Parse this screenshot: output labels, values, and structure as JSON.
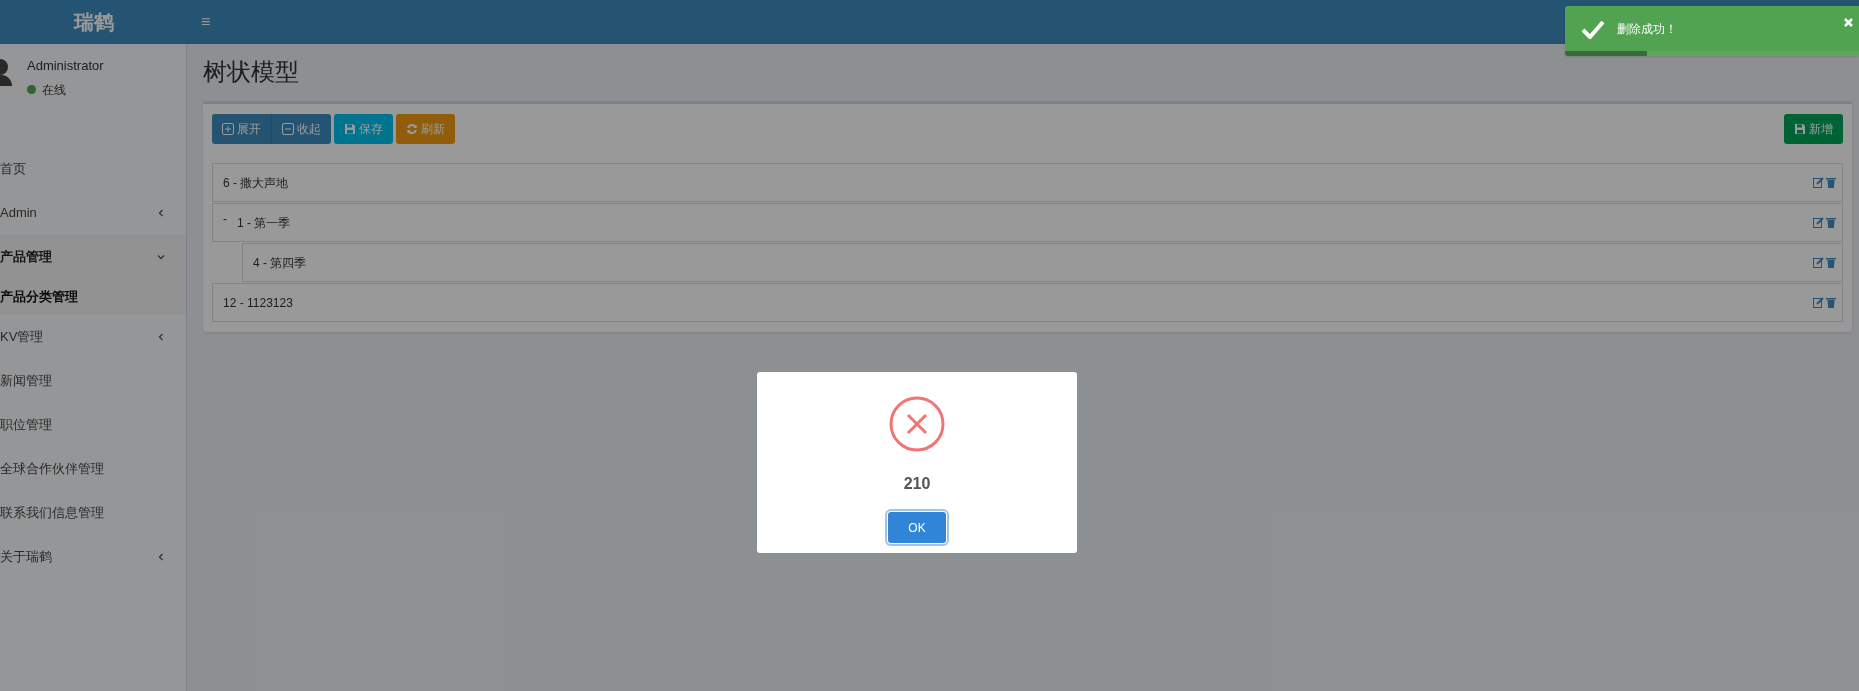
{
  "header": {
    "logo": "瑞鹤",
    "menu_toggle": "≡"
  },
  "sidebar": {
    "user": {
      "name": "Administrator",
      "status": {
        "text": "在线",
        "color": "#2e6435"
      }
    },
    "items": [
      {
        "label": "首页",
        "kind": "link",
        "selected": false
      },
      {
        "label": "Admin",
        "kind": "group",
        "expanded": false,
        "selected": false
      },
      {
        "label": "产品管理",
        "kind": "group",
        "expanded": true,
        "selected": true,
        "children": [
          {
            "label": "产品分类管理",
            "selected": true
          }
        ]
      },
      {
        "label": "KV管理",
        "kind": "group",
        "expanded": false,
        "selected": false
      },
      {
        "label": "新闻管理",
        "kind": "link",
        "selected": false
      },
      {
        "label": "职位管理",
        "kind": "link",
        "selected": false
      },
      {
        "label": "全球合作伙伴管理",
        "kind": "link",
        "selected": false
      },
      {
        "label": "联系我们信息管理",
        "kind": "link",
        "selected": false
      },
      {
        "label": "关于瑞鹤",
        "kind": "group",
        "expanded": false,
        "selected": false
      }
    ]
  },
  "page": {
    "title": "树状模型",
    "toolbar": [
      {
        "label": "展开",
        "kind": "expand"
      },
      {
        "label": "收起",
        "kind": "collapse"
      },
      {
        "label": "保存",
        "kind": "save"
      },
      {
        "label": "刷新",
        "kind": "refresh"
      }
    ],
    "add_button": {
      "label": "新增"
    },
    "tree": [
      {
        "label": "6 - 撒大声地"
      },
      {
        "label": "1 - 第一季",
        "toggle": "-",
        "children": [
          {
            "label": "4 - 第四季"
          }
        ]
      },
      {
        "label": "12 - 1123123"
      }
    ]
  },
  "toast": {
    "message": "删除成功！",
    "level": 0.28
  },
  "dialog": {
    "kind": "error",
    "message": "210",
    "button": "OK"
  }
}
